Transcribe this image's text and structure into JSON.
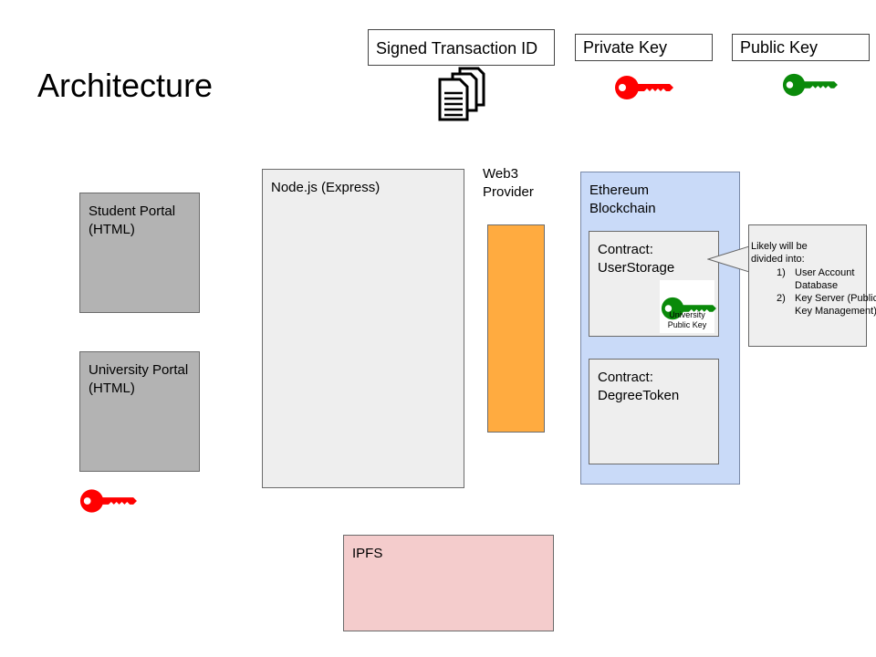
{
  "title": "Architecture",
  "legend": {
    "signed_tx": "Signed Transaction ID",
    "private_key": "Private Key",
    "public_key": "Public Key"
  },
  "boxes": {
    "student_portal": "Student Portal\n(HTML)",
    "university_portal": "University Portal\n(HTML)",
    "nodejs": "Node.js (Express)",
    "web3": "Web3\nProvider",
    "ethereum": "Ethereum\nBlockchain",
    "user_storage": "Contract:\nUserStorage",
    "degree_token": "Contract:\nDegreeToken",
    "ipfs": "IPFS",
    "university_public_key": "University\nPublic Key"
  },
  "callout": {
    "intro": "Likely will be divided into:",
    "items": [
      {
        "num": "1)",
        "text": "User Account Database"
      },
      {
        "num": "2)",
        "text": "Key Server (Public Key Management)"
      }
    ]
  },
  "colors": {
    "private_key": "#ff0000",
    "public_key": "#0a8a0a",
    "portal": "#b3b3b3",
    "server": "#eeeeee",
    "web3": "#ffab40",
    "ethereum": "#c9daf8",
    "ipfs": "#f4cccc"
  }
}
